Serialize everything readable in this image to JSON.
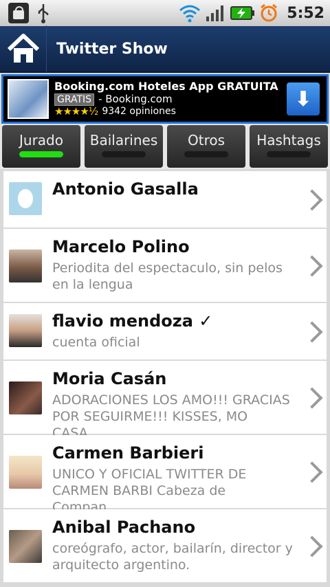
{
  "status_bar": {
    "time": "5:52",
    "icons": [
      "market-icon",
      "usb-icon",
      "wifi-icon",
      "signal-icon",
      "battery-charging-icon",
      "alarm-icon"
    ]
  },
  "title_bar": {
    "title": "Twitter Show",
    "home_icon": "home-icon"
  },
  "ad": {
    "title": "Booking.com Hoteles App GRATUITA",
    "badge": "GRATIS",
    "publisher": "- Booking.com",
    "stars": "★★★★½",
    "reviews": "9342 opiniones",
    "download_icon": "⬇"
  },
  "tabs": [
    {
      "label": "Jurado",
      "active": true
    },
    {
      "label": "Bailarines",
      "active": false
    },
    {
      "label": "Otros",
      "active": false
    },
    {
      "label": "Hashtags",
      "active": false
    }
  ],
  "list": [
    {
      "name": "Antonio Gasalla",
      "desc": ""
    },
    {
      "name": "Marcelo Polino",
      "desc": "Periodita del espectaculo, sin pelos en la lengua"
    },
    {
      "name": "flavio mendoza ✓",
      "desc": "cuenta oficial"
    },
    {
      "name": "Moria Casán",
      "desc": "ADORACIONES LOS AMO!!! GRACIAS POR SEGUIRME!!! KISSES, MO CASA..."
    },
    {
      "name": "Carmen Barbieri",
      "desc": "UNICO Y OFICIAL TWITTER DE CARMEN BARBI Cabeza de Compan..."
    },
    {
      "name": "Anibal Pachano",
      "desc": "coreógrafo, actor, bailarín, director y arquitecto argentino."
    }
  ],
  "colors": {
    "title_bar": "#1d3d6e",
    "active_tab_indicator": "#22dd11",
    "ad_border": "#1f6fd6"
  }
}
